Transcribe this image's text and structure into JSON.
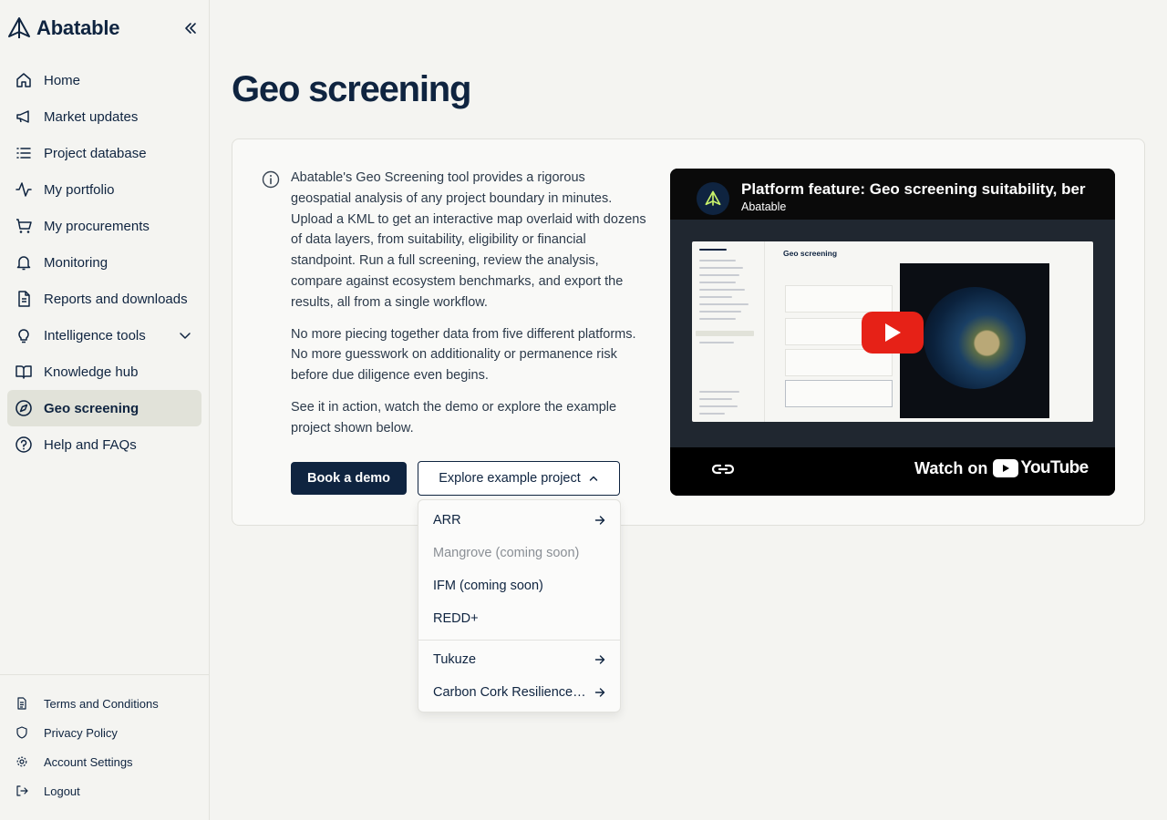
{
  "brand": {
    "name": "Abatable"
  },
  "sidebar": {
    "items": [
      {
        "label": "Home",
        "icon": "home-icon"
      },
      {
        "label": "Market updates",
        "icon": "megaphone-icon"
      },
      {
        "label": "Project database",
        "icon": "list-icon"
      },
      {
        "label": "My portfolio",
        "icon": "activity-icon"
      },
      {
        "label": "My procurements",
        "icon": "cart-icon"
      },
      {
        "label": "Monitoring",
        "icon": "bell-icon"
      },
      {
        "label": "Reports and downloads",
        "icon": "document-icon"
      },
      {
        "label": "Intelligence tools",
        "icon": "lightbulb-icon"
      },
      {
        "label": "Knowledge hub",
        "icon": "book-icon"
      },
      {
        "label": "Geo screening",
        "icon": "compass-icon",
        "active": true
      },
      {
        "label": "Help and FAQs",
        "icon": "help-icon"
      }
    ],
    "footer": [
      {
        "label": "Terms and Conditions",
        "icon": "file-text-icon"
      },
      {
        "label": "Privacy Policy",
        "icon": "shield-icon"
      },
      {
        "label": "Account Settings",
        "icon": "gear-icon"
      },
      {
        "label": "Logout",
        "icon": "logout-icon"
      }
    ]
  },
  "main": {
    "title": "Geo screening",
    "paragraphs": [
      "Abatable's Geo Screening tool provides a rigorous geospatial analysis of any project boundary in minutes. Upload a KML to get an interactive map overlaid with dozens of data layers, from suitability, eligibility or financial standpoint. Run a full screening, review the analysis, compare against ecosystem benchmarks, and export the results, all from a single workflow.",
      "No more piecing together data from five different platforms. No more guesswork on additionality or permanence risk before due diligence even begins.",
      "See it in action, watch the demo or explore the example project shown below."
    ],
    "book_demo_label": "Book a demo",
    "explore_label": "Explore example project"
  },
  "video": {
    "title": "Platform feature: Geo screening suitability, ber",
    "channel": "Abatable",
    "thumb_title": "Geo screening",
    "watch_on": "Watch on",
    "youtube": "YouTube"
  },
  "dropdown": {
    "items": [
      {
        "label": "ARR",
        "arrow": true,
        "disabled": false
      },
      {
        "label": "Mangrove (coming soon)",
        "arrow": false,
        "disabled": true
      },
      {
        "label": "IFM (coming soon)",
        "arrow": false,
        "disabled": false
      },
      {
        "label": "REDD+",
        "arrow": false,
        "disabled": false
      },
      {
        "label": "Tukuze",
        "arrow": true,
        "disabled": false
      },
      {
        "label": "Carbon Cork Resilience Project",
        "arrow": true,
        "disabled": false
      }
    ]
  },
  "colors": {
    "navy": "#0f2440",
    "active_bg": "#e1e2d9",
    "youtube_red": "#e62117"
  }
}
